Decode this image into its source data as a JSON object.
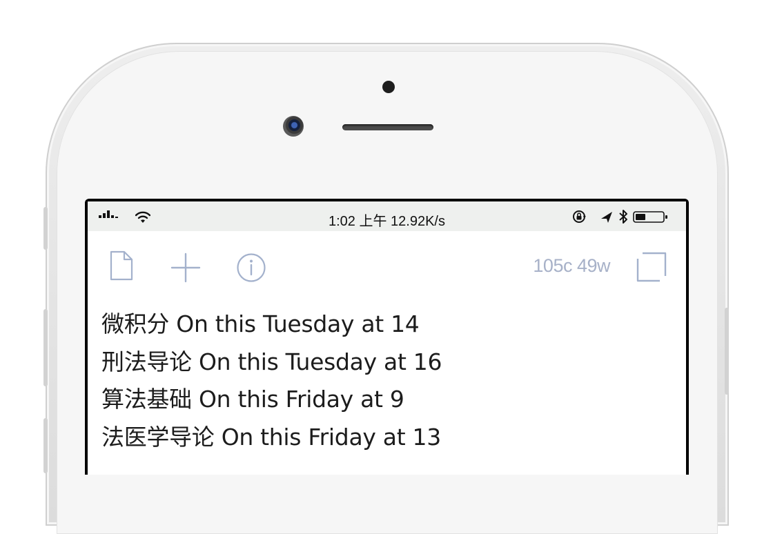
{
  "status_bar": {
    "time_text": "1:02 上午 12.92K/s"
  },
  "toolbar": {
    "new_document_icon": "document-icon",
    "add_icon": "plus-icon",
    "info_icon": "info-icon",
    "count_text": "105c 49w",
    "copy_icon": "copy-icon"
  },
  "note": {
    "lines": [
      "微积分 On this Tuesday at 14",
      "刑法导论 On this Tuesday at 16",
      "算法基础 On this Friday at 9",
      "法医学导论 On this Friday at 13"
    ]
  },
  "colors": {
    "toolbar_icon": "#a3b1cc",
    "text": "#1c1c1c",
    "status_bar_bg": "#eef0ee"
  }
}
